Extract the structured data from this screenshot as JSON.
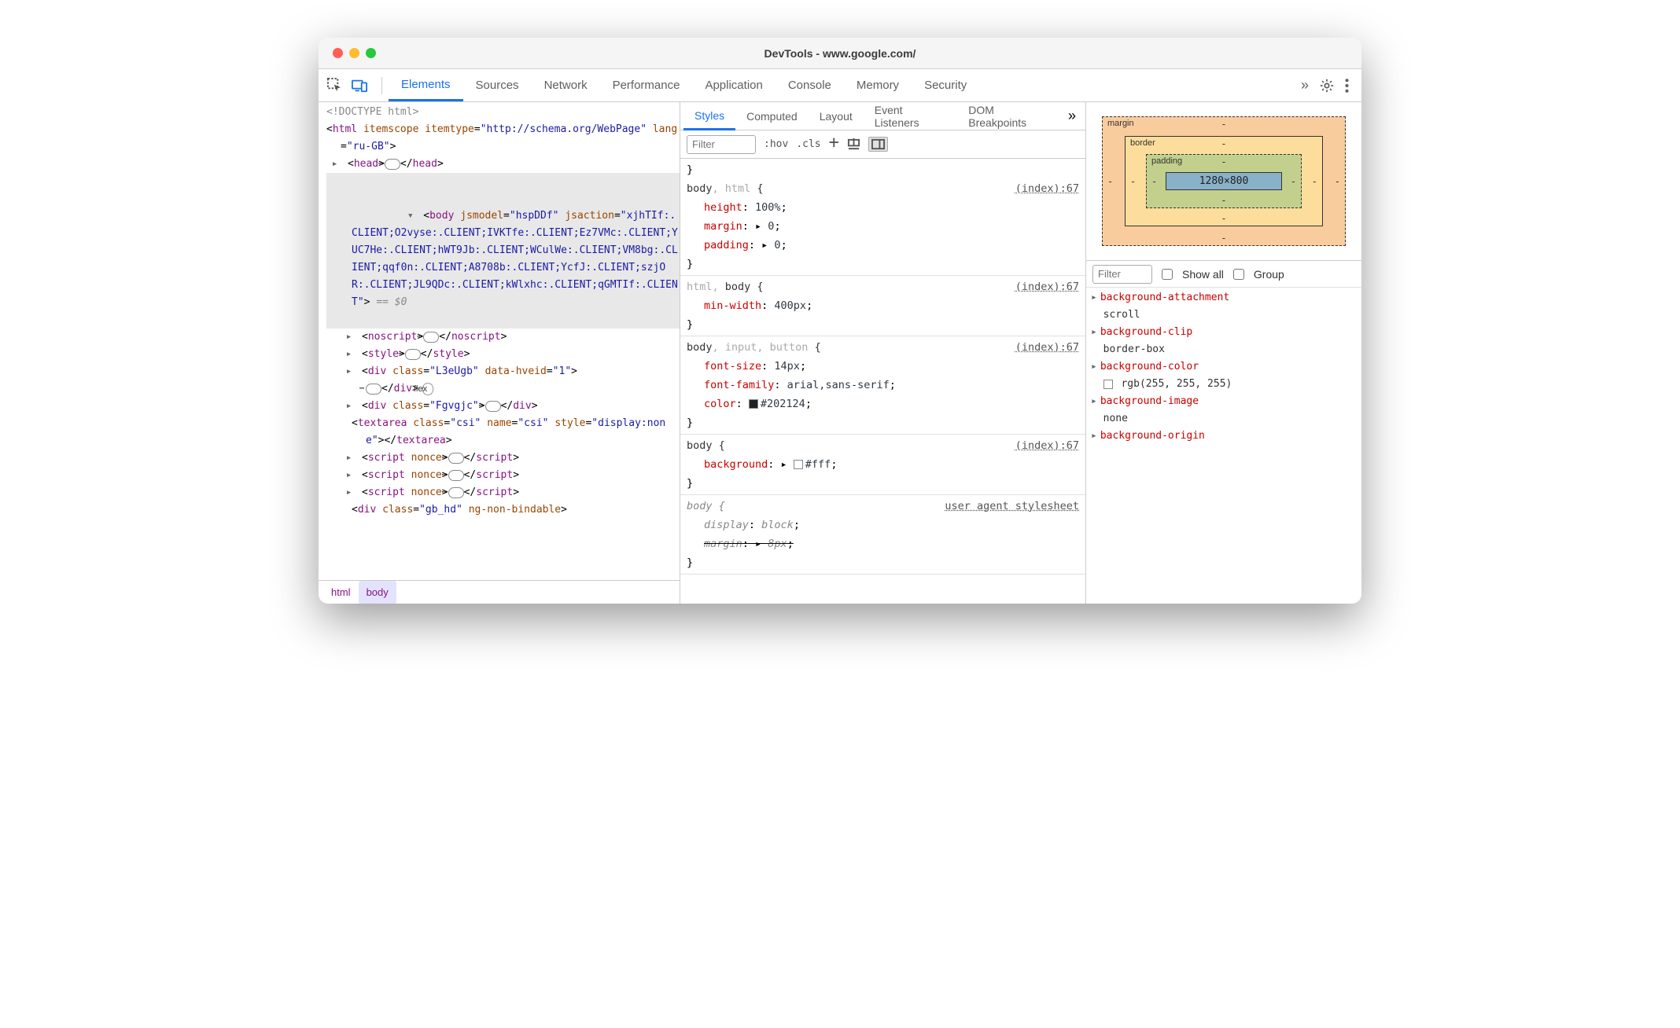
{
  "window": {
    "title": "DevTools - www.google.com/"
  },
  "main_tabs": {
    "items": [
      "Elements",
      "Sources",
      "Network",
      "Performance",
      "Application",
      "Console",
      "Memory",
      "Security"
    ],
    "active": "Elements"
  },
  "sub_tabs": {
    "items": [
      "Styles",
      "Computed",
      "Layout",
      "Event Listeners",
      "DOM Breakpoints"
    ],
    "active": "Styles"
  },
  "styles_toolbar": {
    "filter_placeholder": "Filter",
    "hov": ":hov",
    "cls": ".cls"
  },
  "dom": {
    "doctype": "<!DOCTYPE html>",
    "html_open": {
      "tag": "html",
      "attrs": "itemscope itemtype=\"http://schema.org/WebPage\" lang=\"ru-GB\""
    },
    "head": {
      "tag": "head"
    },
    "body_open": {
      "tag": "body",
      "jsmodel": "hspDDf",
      "jsaction": "xjhTIf:.CLIENT;O2vyse:.CLIENT;IVKTfe:.CLIENT;Ez7VMc:.CLIENT;YUC7He:.CLIENT;hWT9Jb:.CLIENT;WCulWe:.CLIENT;VM8bg:.CLIENT;qqf0n:.CLIENT;A8708b:.CLIENT;YcfJ:.CLIENT;szjOR:.CLIENT;JL9QDc:.CLIENT;kWlxhc:.CLIENT;qGMTIf:.CLIENT",
      "eq0": "== $0"
    },
    "children": [
      {
        "tag": "noscript"
      },
      {
        "tag": "style"
      },
      {
        "tag": "div",
        "attrs": "class=\"L3eUgb\" data-hveid=\"1\"",
        "flex": true
      },
      {
        "tag": "div",
        "attrs": "class=\"Fgvgjc\""
      },
      {
        "tag": "textarea",
        "attrs": "class=\"csi\" name=\"csi\" style=\"display:none\"",
        "noexpand": true
      },
      {
        "tag": "script",
        "attrs": "nonce"
      },
      {
        "tag": "script",
        "attrs": "nonce"
      },
      {
        "tag": "script",
        "attrs": "nonce"
      },
      {
        "tag": "div",
        "attrs": "class=\"gb_hd\" ng-non-bindable",
        "noexpand": true,
        "noclose": true
      }
    ]
  },
  "breadcrumbs": [
    "html",
    "body"
  ],
  "rules": [
    {
      "pre_close": true,
      "selector_parts": [
        {
          "t": "body",
          "dim": false
        },
        {
          "t": ", html",
          "dim": true
        }
      ],
      "source": "(index):67",
      "props": [
        {
          "n": "height",
          "v": "100%"
        },
        {
          "n": "margin",
          "v": "0",
          "tri": true
        },
        {
          "n": "padding",
          "v": "0",
          "tri": true
        }
      ]
    },
    {
      "selector_parts": [
        {
          "t": "html, ",
          "dim": true
        },
        {
          "t": "body",
          "dim": false
        }
      ],
      "source": "(index):67",
      "props": [
        {
          "n": "min-width",
          "v": "400px"
        }
      ]
    },
    {
      "selector_parts": [
        {
          "t": "body",
          "dim": false
        },
        {
          "t": ", input, button",
          "dim": true
        }
      ],
      "source": "(index):67",
      "props": [
        {
          "n": "font-size",
          "v": "14px"
        },
        {
          "n": "font-family",
          "v": "arial,sans-serif"
        },
        {
          "n": "color",
          "v": "#202124",
          "swatch": "#202124"
        }
      ]
    },
    {
      "selector_parts": [
        {
          "t": "body",
          "dim": false
        }
      ],
      "source": "(index):67",
      "props": [
        {
          "n": "background",
          "v": "#fff",
          "tri": true,
          "swatch": "#ffffff"
        }
      ]
    },
    {
      "ua": true,
      "selector_parts": [
        {
          "t": "body",
          "dim": false
        }
      ],
      "source": "user agent stylesheet",
      "props": [
        {
          "n": "display",
          "v": "block"
        },
        {
          "n": "margin",
          "v": "8px",
          "tri": true,
          "strike": true
        }
      ]
    }
  ],
  "box_model": {
    "labels": {
      "margin": "margin",
      "border": "border",
      "padding": "padding"
    },
    "margin": {
      "t": "-",
      "r": "-",
      "b": "-",
      "l": "-"
    },
    "border": {
      "t": "-",
      "r": "-",
      "b": "-",
      "l": "-"
    },
    "padding": {
      "t": "-",
      "r": "-",
      "b": "-",
      "l": "-"
    },
    "content": "1280×800"
  },
  "computed": {
    "filter_placeholder": "Filter",
    "show_all_label": "Show all",
    "group_label": "Group",
    "props": [
      {
        "n": "background-attachment",
        "v": "scroll"
      },
      {
        "n": "background-clip",
        "v": "border-box"
      },
      {
        "n": "background-color",
        "v": "rgb(255, 255, 255)",
        "swatch": "#ffffff"
      },
      {
        "n": "background-image",
        "v": "none"
      },
      {
        "n": "background-origin",
        "v": ""
      }
    ]
  },
  "flex_label": "flex"
}
